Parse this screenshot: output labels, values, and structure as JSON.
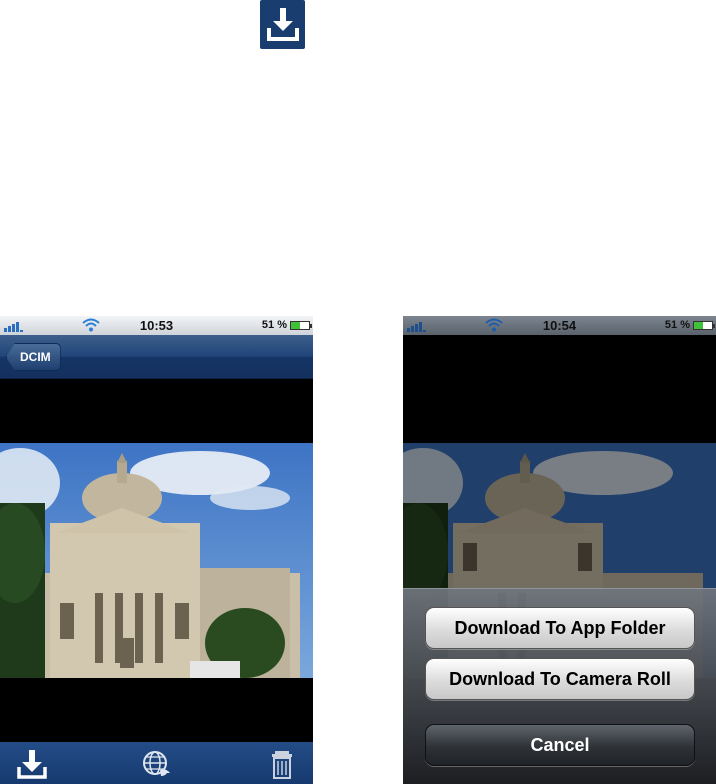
{
  "top_icon": {
    "icon": "download-icon"
  },
  "screens": [
    {
      "status": {
        "time": "10:53",
        "battery": "51 %",
        "battery_level": 0.51
      },
      "nav": {
        "back_label": "DCIM"
      },
      "toolbar": {
        "icons": [
          "download-icon",
          "globe-share-icon",
          "trash-icon"
        ]
      }
    },
    {
      "status": {
        "time": "10:54",
        "battery": "51 %",
        "battery_level": 0.51
      },
      "action_sheet": {
        "download_app_folder": "Download To App Folder",
        "download_camera_roll": "Download To Camera Roll",
        "cancel": "Cancel"
      }
    }
  ],
  "colors": {
    "nav_blue": "#1a3d70",
    "toolbar_blue": "#1d4279",
    "battery_green": "#3fc23a"
  }
}
